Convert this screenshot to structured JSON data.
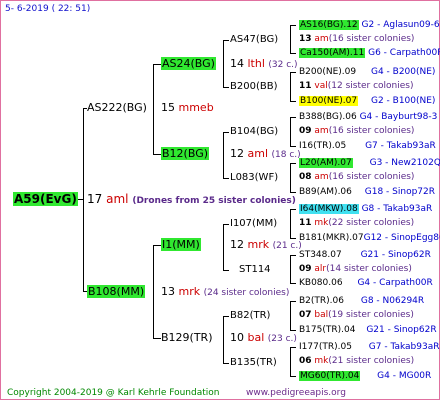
{
  "header": {
    "date": "5- 6-2019 ( 22: 51)"
  },
  "root": {
    "name": "A59(EvG)",
    "gen": "17",
    "label": "aml",
    "note": "(Drones from 25 sister colonies)"
  },
  "p1": {
    "name": "AS222(BG)",
    "gen": "15",
    "label": "mmeb"
  },
  "p1a": {
    "name": "AS24(BG)",
    "gen": "14",
    "label": "lthl",
    "count": "(32 c.)"
  },
  "p1b": {
    "name": "B12(BG)",
    "gen": "12",
    "label": "aml",
    "count": "(18 c.)"
  },
  "p2": {
    "name": "B108(MM)",
    "gen": "13",
    "label": "mrk",
    "note": "(24 sister colonies)"
  },
  "p2a": {
    "name": "I1(MM)",
    "gen": "12",
    "label": "mrk",
    "count": "(21 c.)"
  },
  "p2b": {
    "name": "B129(TR)",
    "gen": "10",
    "label": "bal",
    "count": "(23 c.)"
  },
  "g3": [
    {
      "name": "AS47(BG)"
    },
    {
      "name": "B200(BB)"
    },
    {
      "name": "B104(BG)"
    },
    {
      "name": "L083(WF)"
    },
    {
      "name": "I107(MM)"
    },
    {
      "name": "ST114"
    },
    {
      "name": "B82(TR)"
    },
    {
      "name": "B135(TR)"
    }
  ],
  "g4": [
    {
      "a": "AS16(BG).12",
      "b": "G2 - Aglasun09-6"
    },
    {
      "a": "13",
      "b": "am",
      "c": "(16 sister colonies)"
    },
    {
      "a": "Ca150(AM).11",
      "b": "G6 - Carpath00R"
    },
    {
      "a": "B200(NE).09",
      "b": "G4 - B200(NE)"
    },
    {
      "a": "11",
      "b": "val",
      "c": "(12 sister colonies)"
    },
    {
      "a": "B100(NE).07",
      "b": "G2 - B100(NE)"
    },
    {
      "a": "B388(BG).06",
      "b": "G4 - Bayburt98-3"
    },
    {
      "a": "09",
      "b": "am",
      "c": "(16 sister colonies)"
    },
    {
      "a": "I16(TR).05",
      "b": "G7 - Takab93aR"
    },
    {
      "a": "L20(AM).07",
      "b": "G3 - New2102Q"
    },
    {
      "a": "08",
      "b": "am",
      "c": "(16 sister colonies)"
    },
    {
      "a": "B89(AM).06",
      "b": "G18 - Sinop72R"
    },
    {
      "a": "I64(MKW).08",
      "b": "G8 - Takab93aR"
    },
    {
      "a": "11",
      "b": "mk",
      "c": "(22 sister colonies)"
    },
    {
      "a": "B181(MKR).07",
      "b": "G12 - SinopEgg86R"
    },
    {
      "a": "ST348.07",
      "b": "G21 - Sinop62R"
    },
    {
      "a": "09",
      "b": "alr",
      "c": "(14 sister colonies)"
    },
    {
      "a": "KB080.06",
      "b": "G4 - Carpath00R"
    },
    {
      "a": "B2(TR).06",
      "b": "G8 - N06294R"
    },
    {
      "a": "07",
      "b": "bal",
      "c": "(19 sister colonies)"
    },
    {
      "a": "B175(TR).04",
      "b": "G21 - Sinop62R"
    },
    {
      "a": "I177(TR).05",
      "b": "G7 - Takab93aR"
    },
    {
      "a": "06",
      "b": "mk",
      "c": "(21 sister colonies)"
    },
    {
      "a": "MG60(TR).04",
      "b": "G4 - MG00R"
    }
  ],
  "footer": {
    "copyright": "Copyright 2004-2019 @ Karl Kehrle Foundation",
    "site": "www.pedigreeapis.org"
  }
}
